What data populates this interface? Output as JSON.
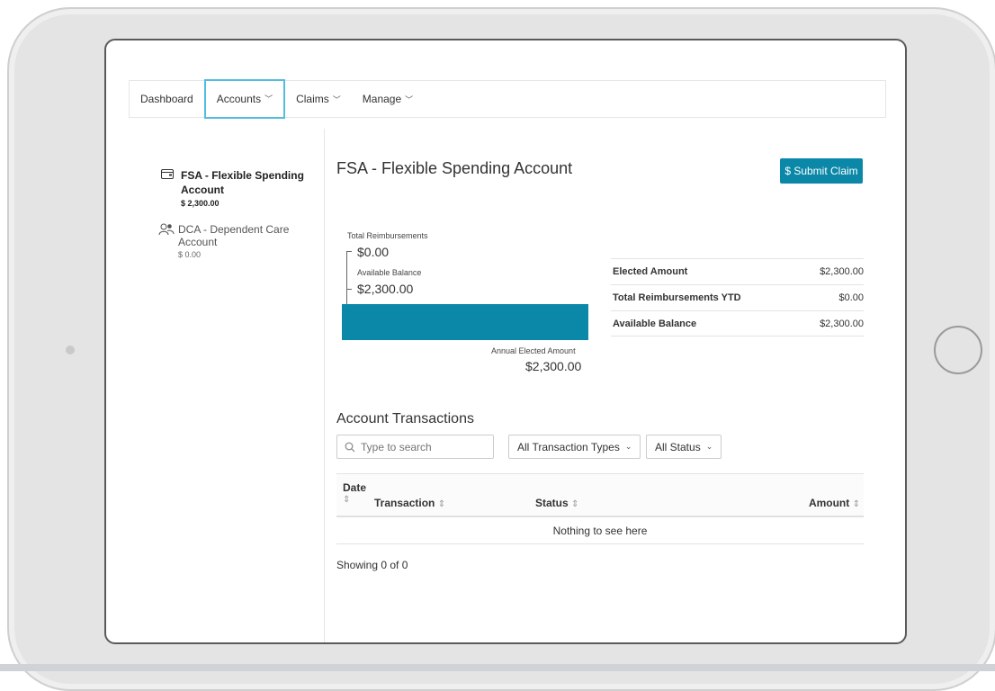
{
  "nav": {
    "items": [
      {
        "label": "Dashboard",
        "has_chevron": false
      },
      {
        "label": "Accounts",
        "has_chevron": true,
        "active": true
      },
      {
        "label": "Claims",
        "has_chevron": true
      },
      {
        "label": "Manage",
        "has_chevron": true
      }
    ]
  },
  "sidebar": {
    "accounts": [
      {
        "name": "FSA - Flexible Spending Account",
        "amount": "$ 2,300.00",
        "icon": "wallet-icon",
        "selected": true
      },
      {
        "name": "DCA - Dependent Care Account",
        "amount": "$ 0.00",
        "icon": "people-icon",
        "selected": false
      }
    ]
  },
  "main": {
    "title": "FSA - Flexible Spending Account",
    "submit_button": "$ Submit Claim",
    "total_reimbursements_label": "Total Reimbursements",
    "total_reimbursements_value": "$0.00",
    "available_balance_label": "Available Balance",
    "available_balance_value": "$2,300.00",
    "annual_elected_label": "Annual Elected Amount",
    "annual_elected_value": "$2,300.00",
    "bar_fill_fraction": 1.0,
    "bar_color": "#0b88a8",
    "summary": [
      {
        "label": "Elected Amount",
        "value": "$2,300.00"
      },
      {
        "label": "Total Reimbursements YTD",
        "value": "$0.00"
      },
      {
        "label": "Available Balance",
        "value": "$2,300.00"
      }
    ]
  },
  "transactions": {
    "title": "Account Transactions",
    "search_placeholder": "Type to search",
    "type_filter": "All Transaction Types",
    "status_filter": "All Status",
    "columns": {
      "date": "Date",
      "transaction": "Transaction",
      "status": "Status",
      "amount": "Amount"
    },
    "empty_message": "Nothing to see here",
    "showing": "Showing  0  of  0"
  },
  "colors": {
    "accent": "#0b88a8",
    "focus": "#52bde0"
  }
}
